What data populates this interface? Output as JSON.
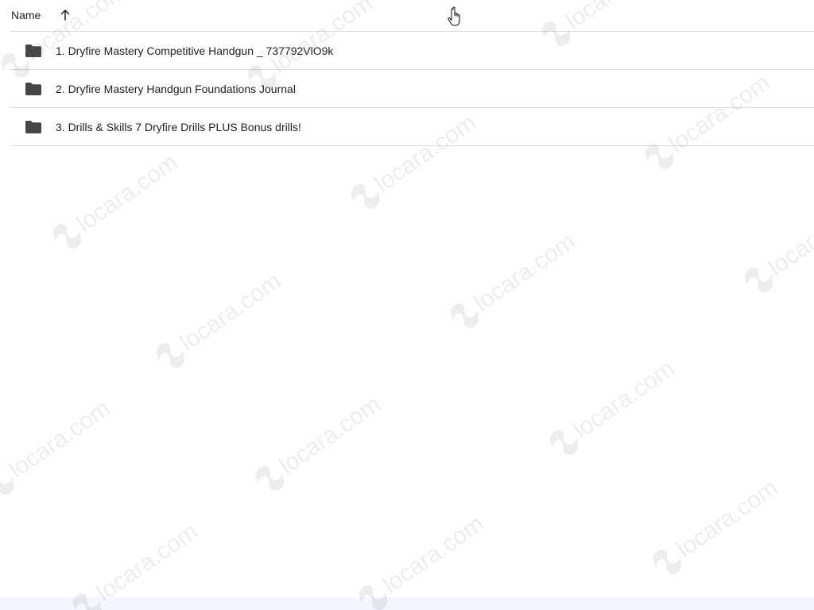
{
  "header": {
    "name_label": "Name"
  },
  "files": [
    {
      "name": "1. Dryfire Mastery Competitive Handgun _ 737792VlO9k",
      "icon": "folder-icon"
    },
    {
      "name": "2. Dryfire Mastery Handgun Foundations Journal",
      "icon": "folder-icon"
    },
    {
      "name": "3. Drills & Skills 7 Dryfire Drills PLUS Bonus drills!",
      "icon": "folder-icon"
    }
  ],
  "watermark": {
    "text": "locara.com"
  },
  "colors": {
    "divider": "#dadce0",
    "text": "#1f1f1f",
    "icon": "#444746",
    "bottom_band": "#f3f6fc"
  }
}
